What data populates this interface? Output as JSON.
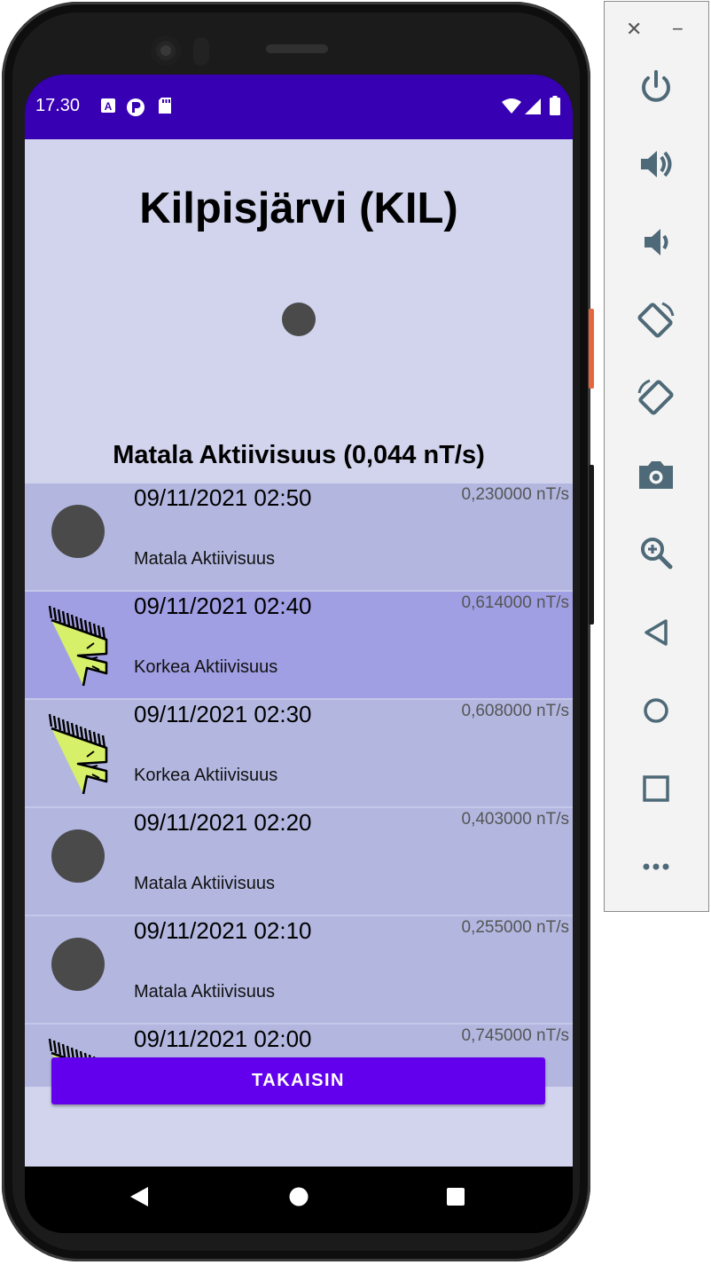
{
  "status_bar": {
    "time": "17.30"
  },
  "app": {
    "title": "Kilpisjärvi (KIL)",
    "current_status": "Matala Aktiivisuus (0,044 nT/s)",
    "back_button_label": "TAKAISIN"
  },
  "readings": [
    {
      "time": "09/11/2021 02:50",
      "value": "0,230000 nT/s",
      "label": "Matala Aktiivisuus",
      "icon": "low-activity-dot-icon",
      "selected": false
    },
    {
      "time": "09/11/2021 02:40",
      "value": "0,614000 nT/s",
      "label": "Korkea Aktiivisuus",
      "icon": "aurora-icon",
      "selected": true
    },
    {
      "time": "09/11/2021 02:30",
      "value": "0,608000 nT/s",
      "label": "Korkea Aktiivisuus",
      "icon": "aurora-icon",
      "selected": false
    },
    {
      "time": "09/11/2021 02:20",
      "value": "0,403000 nT/s",
      "label": "Matala Aktiivisuus",
      "icon": "low-activity-dot-icon",
      "selected": false
    },
    {
      "time": "09/11/2021 02:10",
      "value": "0,255000 nT/s",
      "label": "Matala Aktiivisuus",
      "icon": "low-activity-dot-icon",
      "selected": false
    },
    {
      "time": "09/11/2021 02:00",
      "value": "0,745000 nT/s",
      "label": "",
      "icon": "aurora-icon",
      "selected": false
    }
  ],
  "emulator_panel": {
    "close_glyph": "✕",
    "minimize_glyph": "−",
    "tools": [
      "power-icon",
      "volume-up-icon",
      "volume-down-icon",
      "rotate-left-icon",
      "rotate-right-icon",
      "camera-icon",
      "zoom-icon",
      "back-icon",
      "home-icon",
      "overview-icon",
      "more-icon"
    ]
  },
  "colors": {
    "status_bar": "#3700b3",
    "app_background": "#d1d4ec",
    "row_background": "#b3b7e0",
    "row_selected": "#a19fe3",
    "button": "#6200ee"
  }
}
